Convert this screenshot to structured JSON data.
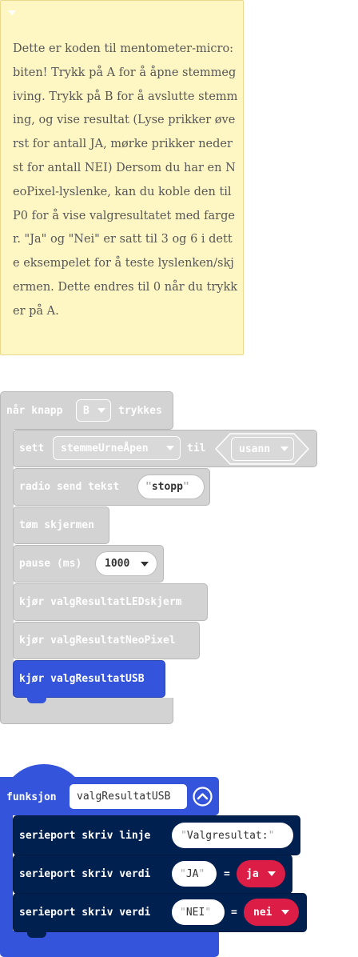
{
  "comment": {
    "text": "Dette er koden til mentometer-micro:biten! Trykk på A for å åpne stemmegiving. Trykk på B for å avslutte stemming, og vise resultat (Lyse prikker øverst for antall JA, mørke prikker nederst for antall NEI) Dersom du har en NeoPixel-lyslenke, kan du koble den til P0 for å vise valgresultatet med farger. \"Ja\" og \"Nei\" er satt til 3 og 6 i dette eksempelet for å teste lyslenken/skjermen. Dette endres til 0 når du trykker på A."
  },
  "event_block": {
    "label_prefix": "når knapp",
    "button_value": "B",
    "label_suffix": "trykkes",
    "set_label": "sett",
    "set_variable": "stemmeUrneÅpen",
    "set_to_label": "til",
    "set_value": "usann",
    "radio_label": "radio send tekst",
    "radio_value": "stopp",
    "clear_label": "tøm skjermen",
    "pause_label": "pause (ms)",
    "pause_value": "1000",
    "call1": "kjør valgResultatLEDskjerm",
    "call2": "kjør valgResultatNeoPixel",
    "call3": "kjør valgResultatUSB"
  },
  "function_block": {
    "label": "funksjon",
    "name": "valgResultatUSB",
    "line_label": "serieport skriv linje",
    "line_value": "Valgresultat:",
    "value_label": "serieport skriv verdi",
    "row1_key": "JA",
    "row1_eq": "=",
    "row1_var": "ja",
    "row2_key": "NEI",
    "row2_eq": "=",
    "row2_var": "nei"
  },
  "icons": {
    "comment_toggle": "chevron-down-icon",
    "dropdown": "dropdown-arrow-icon",
    "collapse": "collapse-up-icon"
  },
  "colors": {
    "comment_bg": "#fef7c3",
    "disabled_block": "#d3d3d3",
    "function_block": "#3455db",
    "serial_block": "#002050",
    "variable_pill": "#dc1e46"
  }
}
